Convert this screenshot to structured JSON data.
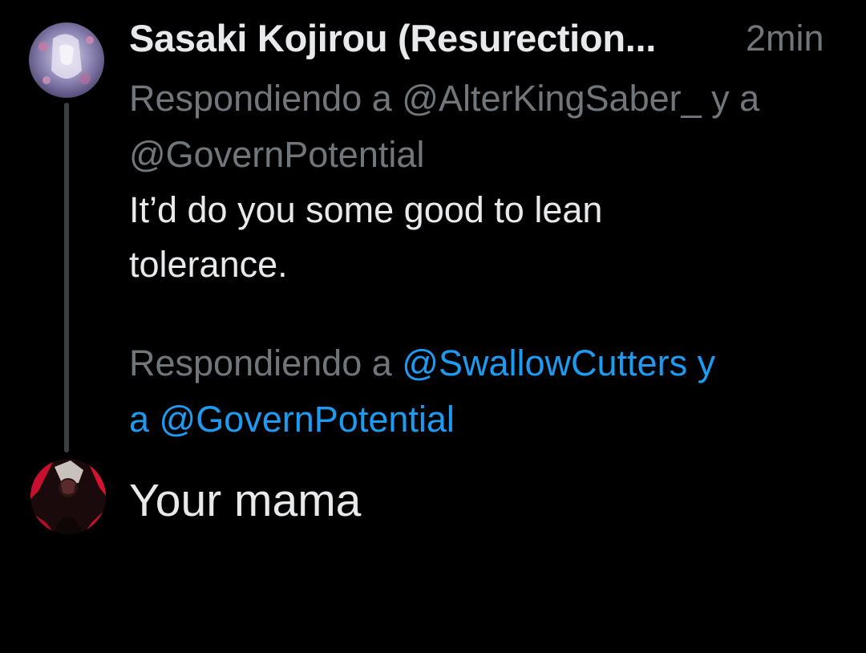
{
  "tweet": {
    "author_name": "Sasaki Kojirou (Resurection...",
    "timestamp": "2min",
    "replying_line1": "Respondiendo a @AlterKingSaber_ y a",
    "replying_line2": "@GovernPotential",
    "text_line1": "It’d do you some good to lean",
    "text_line2": "tolerance."
  },
  "reply": {
    "prefix": "Respondiendo a ",
    "mention_1": "@SwallowCutters y",
    "mention_2": "a @GovernPotential",
    "draft_text": "Your mama"
  },
  "colors": {
    "background": "#000000",
    "primary_text": "#e7e9ea",
    "secondary_text": "#71767b",
    "link": "#1d9bf0",
    "thread_line": "#3b3f44"
  }
}
